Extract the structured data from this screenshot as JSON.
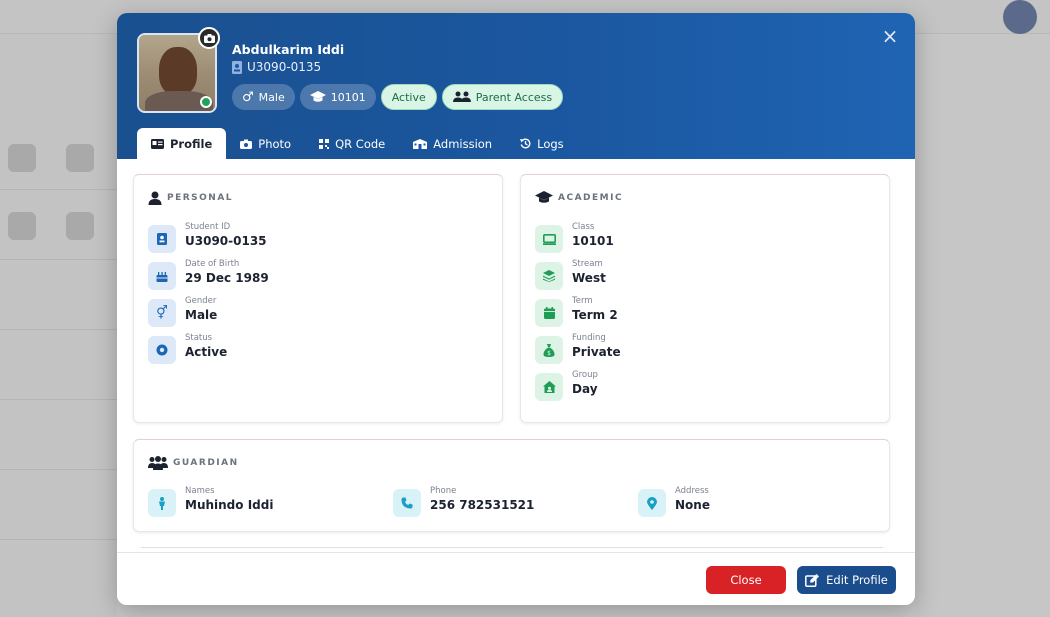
{
  "student": {
    "name": "Abdulkarim Iddi",
    "id": "U3090-0135",
    "pills": {
      "gender": "Male",
      "class": "10101",
      "status": "Active",
      "access": "Parent Access"
    }
  },
  "tabs": [
    {
      "label": "Profile",
      "icon": "id-card-icon"
    },
    {
      "label": "Photo",
      "icon": "camera-icon"
    },
    {
      "label": "QR Code",
      "icon": "qr-code-icon"
    },
    {
      "label": "Admission",
      "icon": "school-icon"
    },
    {
      "label": "Logs",
      "icon": "history-icon"
    }
  ],
  "personal": {
    "title": "PERSONAL",
    "items": [
      {
        "label": "Student ID",
        "value": "U3090-0135",
        "icon": "id-badge-icon"
      },
      {
        "label": "Date of Birth",
        "value": "29 Dec 1989",
        "icon": "cake-icon"
      },
      {
        "label": "Gender",
        "value": "Male",
        "icon": "gender-icon"
      },
      {
        "label": "Status",
        "value": "Active",
        "icon": "status-dot-icon"
      }
    ]
  },
  "academic": {
    "title": "ACADEMIC",
    "items": [
      {
        "label": "Class",
        "value": "10101",
        "icon": "screen-icon"
      },
      {
        "label": "Stream",
        "value": "West",
        "icon": "layers-icon"
      },
      {
        "label": "Term",
        "value": "Term 2",
        "icon": "calendar-icon"
      },
      {
        "label": "Funding",
        "value": "Private",
        "icon": "money-bag-icon"
      },
      {
        "label": "Group",
        "value": "Day",
        "icon": "house-icon"
      }
    ]
  },
  "guardian": {
    "title": "GUARDIAN",
    "items": [
      {
        "label": "Names",
        "value": "Muhindo Iddi",
        "icon": "person-icon"
      },
      {
        "label": "Phone",
        "value": "256 782531521",
        "icon": "phone-icon"
      },
      {
        "label": "Address",
        "value": "None",
        "icon": "map-pin-icon"
      }
    ]
  },
  "footer": {
    "close_label": "Close",
    "edit_label": "Edit Profile"
  },
  "colors": {
    "header": "#1b57a0",
    "accent_blue": "#1b4c8c",
    "danger": "#d92226",
    "success": "#22a35a"
  }
}
